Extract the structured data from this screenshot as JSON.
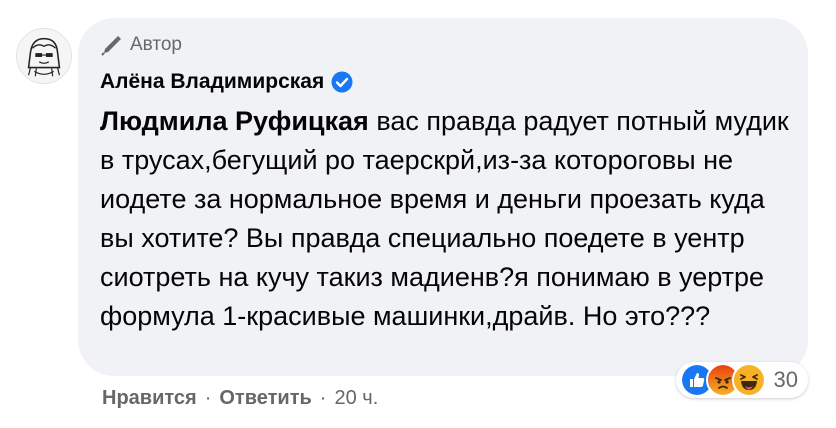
{
  "comment": {
    "author_badge_label": "Автор",
    "author_name": "Алёна Владимирская",
    "mention": "Людмила Руфицкая",
    "text": " вас правда радует потный мудик в трусах,бегущий ро таерскрй,из-за которогов‍ы не иодете за нормальное время и деньги проезать куда вы хотите? Вы правда специально поедете в уентр сиотреть на кучу такиз мадиенв?я понимаю в уертре формула 1-красивые машинки,драйв. Но это???",
    "reactions": {
      "icons": [
        "like-icon",
        "angry-icon",
        "haha-icon"
      ],
      "count": "30"
    },
    "actions": {
      "like_label": "Нравится",
      "separator": "·",
      "reply_label": "Ответить",
      "time": "20 ч."
    }
  },
  "colors": {
    "bubble": "#f0f2f5",
    "text": "#050505",
    "secondary": "#65676b",
    "verified": "#1877f2",
    "like": "#1877f2",
    "angry": "#e9710f",
    "haha": "#f7b125"
  }
}
